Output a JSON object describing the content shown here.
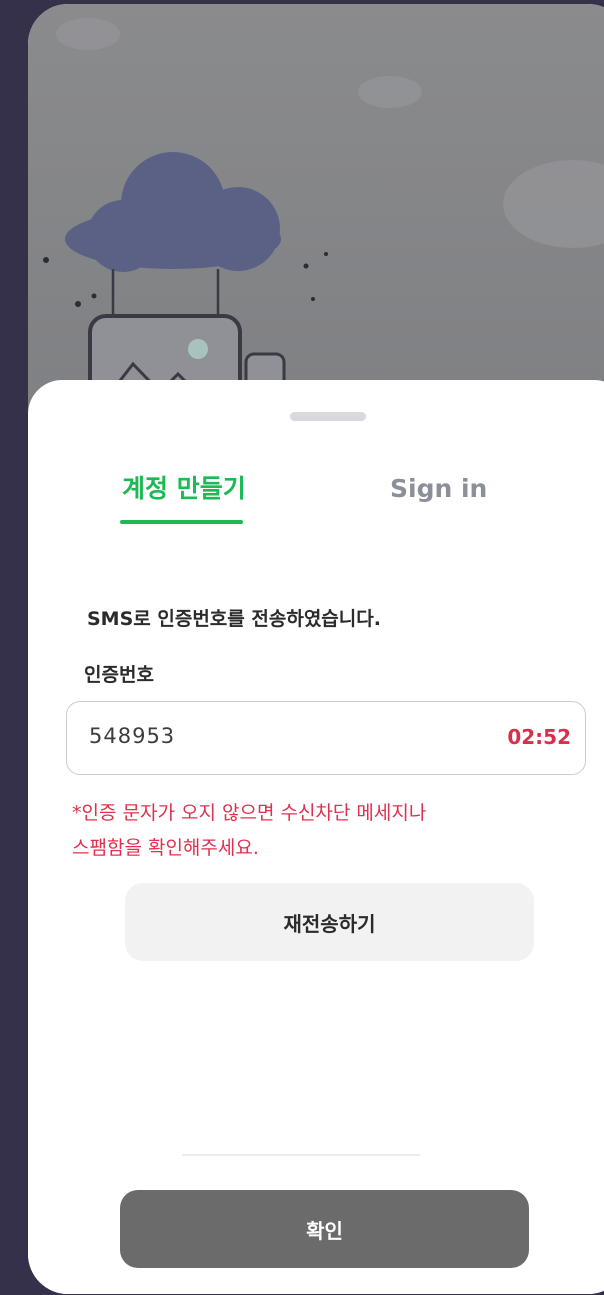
{
  "tabs": {
    "signup_label": "계정 만들기",
    "signin_label": "Sign in",
    "active": "signup"
  },
  "verification": {
    "notice": "SMS로 인증번호를 전송하였습니다.",
    "code_label": "인증번호",
    "code_value": "548953",
    "timer": "02:52",
    "warning_line1": "*인증 문자가 오지 않으면 수신차단 메세지나",
    "warning_line2": "스팸함을 확인해주세요.",
    "resend_label": "재전송하기"
  },
  "footer": {
    "confirm_label": "확인"
  },
  "colors": {
    "accent": "#1db954",
    "error": "#e0304e",
    "confirm_disabled": "#6b6b6b",
    "secondary_button": "#f2f2f3"
  },
  "icons": {
    "illustration": "cloud-photo-illustration"
  }
}
